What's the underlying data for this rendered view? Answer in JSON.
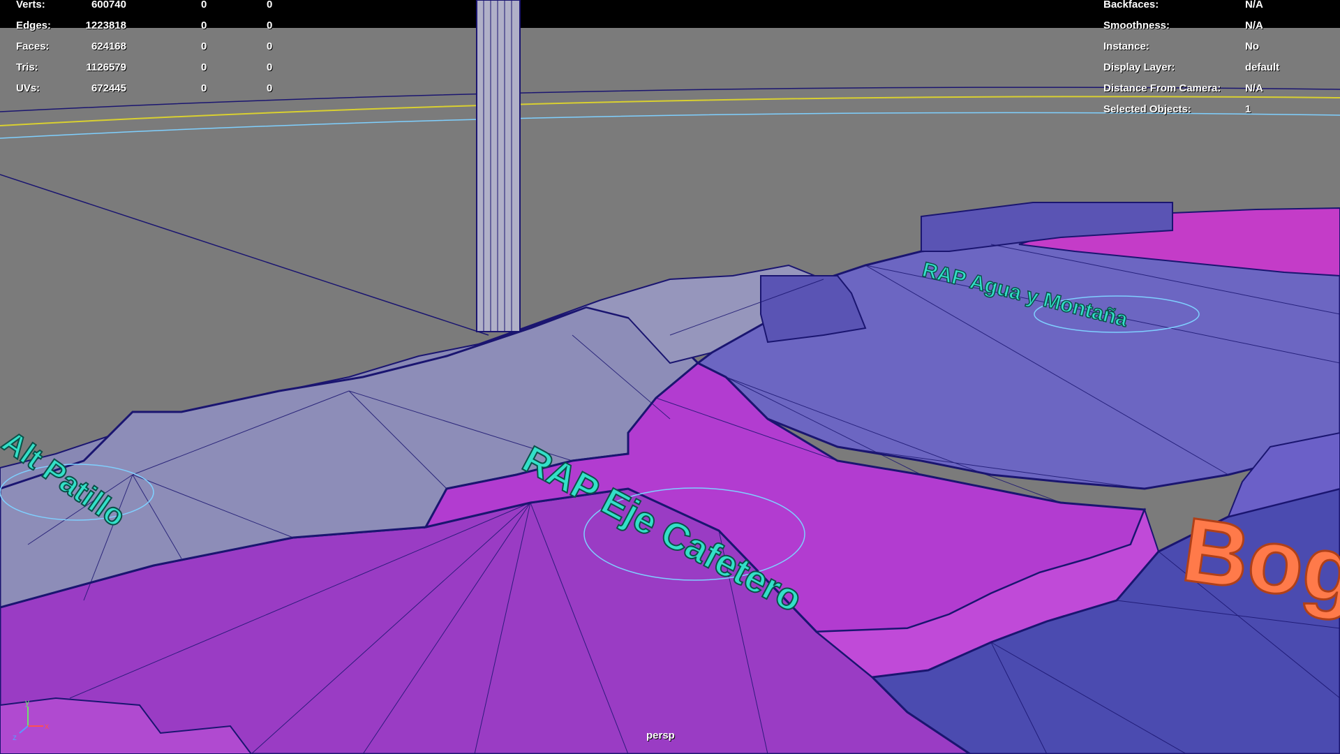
{
  "viewport": {
    "camera": "persp",
    "colors": {
      "background": "#7b7b7b",
      "topbar": "#000000",
      "wire": "#1a1570",
      "lavender": "#8f8fb6",
      "blue_region": "#6a64c0",
      "magenta_region": "#c838c8",
      "purple_region": "#9a3cc4",
      "dark_blue_region": "#4b4bb0",
      "label_cyan": "#33e0c8",
      "label_orange": "#ff7a4a"
    }
  },
  "hud_left": {
    "rows": [
      {
        "label": "Verts:",
        "v1": "600740",
        "v2": "0",
        "v3": "0"
      },
      {
        "label": "Edges:",
        "v1": "1223818",
        "v2": "0",
        "v3": "0"
      },
      {
        "label": "Faces:",
        "v1": "624168",
        "v2": "0",
        "v3": "0"
      },
      {
        "label": "Tris:",
        "v1": "1126579",
        "v2": "0",
        "v3": "0"
      },
      {
        "label": "UVs:",
        "v1": "672445",
        "v2": "0",
        "v3": "0"
      }
    ]
  },
  "hud_right": {
    "rows": [
      {
        "label": "Backfaces:",
        "value": "N/A"
      },
      {
        "label": "Smoothness:",
        "value": "N/A"
      },
      {
        "label": "Instance:",
        "value": "No"
      },
      {
        "label": "Display Layer:",
        "value": "default"
      },
      {
        "label": "Distance From Camera:",
        "value": "N/A"
      },
      {
        "label": "Selected Objects:",
        "value": "1"
      }
    ]
  },
  "scene_labels": {
    "label_left": "Alt Patillo",
    "label_center": "RAP Eje Cafetero",
    "label_right_top": "RAP Agua y Montaña",
    "label_orange": "Bog"
  },
  "axis": {
    "y": "y",
    "x": "x",
    "z": "z"
  }
}
